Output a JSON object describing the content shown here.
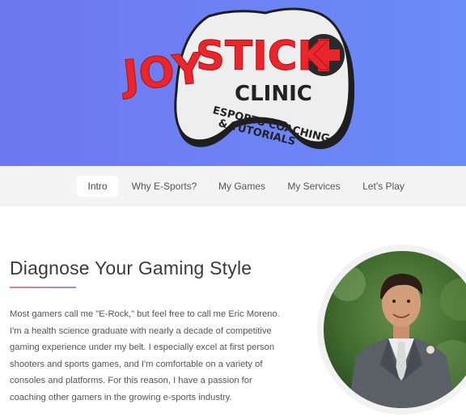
{
  "hero": {
    "logo": {
      "word1": "JOY",
      "word2": "STICK",
      "word3": "CLINIC",
      "tagline1": "ESPORTS COACHING",
      "tagline2": "& TUTORIALS",
      "colors": {
        "red": "#e8262b",
        "controller": "#eeeeee",
        "outline": "#1e1e1e",
        "cross_bg": "#2a2a2a"
      }
    },
    "background_colors": [
      "#6e78ee",
      "#6a8cf8"
    ]
  },
  "nav": {
    "items": [
      {
        "label": "Intro",
        "active": true
      },
      {
        "label": "Why E-Sports?",
        "active": false
      },
      {
        "label": "My Games",
        "active": false
      },
      {
        "label": "My Services",
        "active": false
      },
      {
        "label": "Let’s Play",
        "active": false
      }
    ]
  },
  "main": {
    "title": "Diagnose Your Gaming Style",
    "paragraph": "Most gamers call me \"E-Rock,\" but feel free to call me Eric Moreno. I'm a health science graduate with nearly a decade of competitive gaming experience under my belt. I especially excel at first person shooters and sports games, and I'm comfortable on a variety of consoles and platforms. For this reason, I have a passion for coaching other gamers in the growing e-sports industry.",
    "accent_colors": [
      "#f07a8a",
      "#8a90f0"
    ]
  }
}
